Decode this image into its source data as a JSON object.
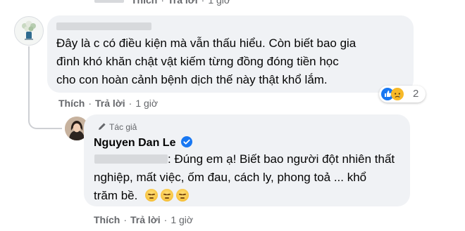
{
  "top_comment": {
    "actions": {
      "like": "Thích",
      "reply": "Trả lời",
      "time": "1 giờ"
    }
  },
  "comment1": {
    "text_lines": [
      "Đây là c có điều kiện mà vẫn thấu hiểu. Còn biết bao gia",
      "đình khó khăn chật vật kiếm từng đồng đóng tiền học",
      "cho con hoàn cảnh bệnh dịch thế này thật khổ lắm."
    ],
    "reaction_count": "2",
    "reaction_icons": [
      "like-icon",
      "sad-icon"
    ],
    "actions": {
      "like": "Thích",
      "reply": "Trả lời",
      "time": "1 giờ"
    }
  },
  "reply": {
    "author_badge": "Tác giả",
    "author_name": "Nguyen Dan Le",
    "verified_icon": "verified-badge-icon",
    "text_line1": ": Đúng em ạ! Biết bao người đột nhiên thất",
    "text_line2": "nghiệp, mất việc, ốm đau, cách ly, phong toả ... khổ",
    "text_line3": "trăm bề.",
    "emojis": [
      "pensive-emoji",
      "pensive-emoji",
      "pensive-emoji"
    ],
    "actions": {
      "like": "Thích",
      "reply": "Trả lời",
      "time": "1 giờ"
    }
  },
  "colors": {
    "bubble": "#f0f2f5",
    "meta_text": "#65676b",
    "text": "#050505",
    "verified": "#1877f2",
    "like_blue": "#1877f2",
    "sad_yellow": "#f7b928"
  }
}
